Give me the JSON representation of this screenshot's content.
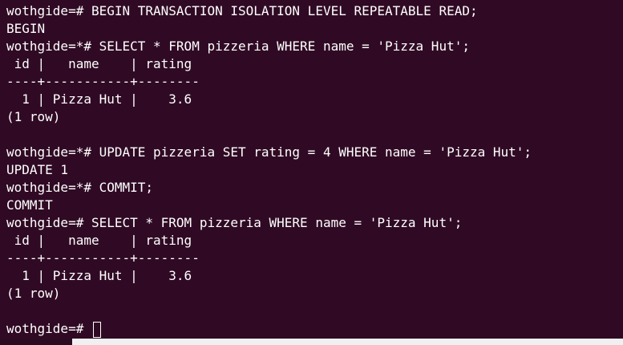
{
  "terminal": {
    "lines": [
      "wothgide=# BEGIN TRANSACTION ISOLATION LEVEL REPEATABLE READ;",
      "BEGIN",
      "wothgide=*# SELECT * FROM pizzeria WHERE name = 'Pizza Hut';",
      " id |   name    | rating",
      "----+-----------+--------",
      "  1 | Pizza Hut |    3.6",
      "(1 row)",
      "",
      "wothgide=*# UPDATE pizzeria SET rating = 4 WHERE name = 'Pizza Hut';",
      "UPDATE 1",
      "wothgide=*# COMMIT;",
      "COMMIT",
      "wothgide=# SELECT * FROM pizzeria WHERE name = 'Pizza Hut';",
      " id |   name    | rating",
      "----+-----------+--------",
      "  1 | Pizza Hut |    3.6",
      "(1 row)",
      ""
    ],
    "prompt": "wothgide=# "
  },
  "colors": {
    "background": "#300a24",
    "foreground": "#ffffff"
  }
}
